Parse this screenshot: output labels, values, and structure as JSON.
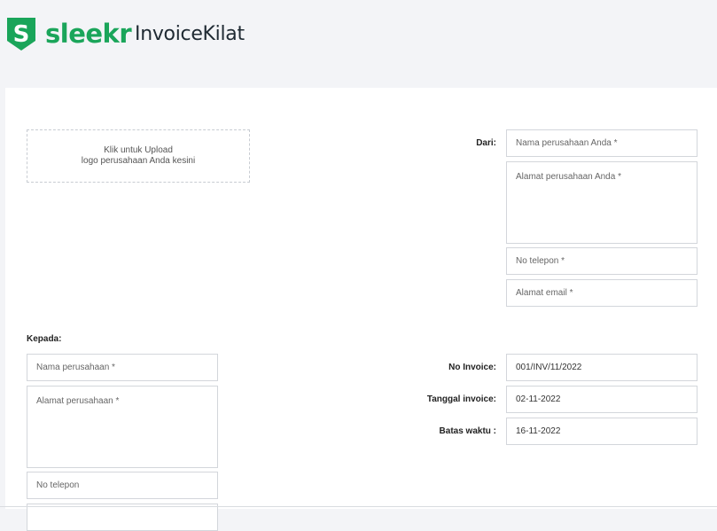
{
  "header": {
    "logo_letter": "S",
    "brand_name": "sleekr",
    "product_name": "InvoiceKilat",
    "brand_color": "#1aa55a"
  },
  "upload": {
    "line1": "Klik untuk Upload",
    "line2": "logo perusahaan Anda kesini"
  },
  "from": {
    "label": "Dari:",
    "company_placeholder": "Nama perusahaan Anda *",
    "address_placeholder": "Alamat perusahaan Anda *",
    "phone_placeholder": "No telepon *",
    "email_placeholder": "Alamat email *"
  },
  "to": {
    "label": "Kepada:",
    "company_placeholder": "Nama perusahaan *",
    "address_placeholder": "Alamat perusahaan *",
    "phone_placeholder": "No telepon"
  },
  "invoice": {
    "number_label": "No Invoice:",
    "number_value": "001/INV/11/2022",
    "date_label": "Tanggal invoice:",
    "date_value": "02-11-2022",
    "due_label": "Batas waktu :",
    "due_value": "16-11-2022"
  }
}
